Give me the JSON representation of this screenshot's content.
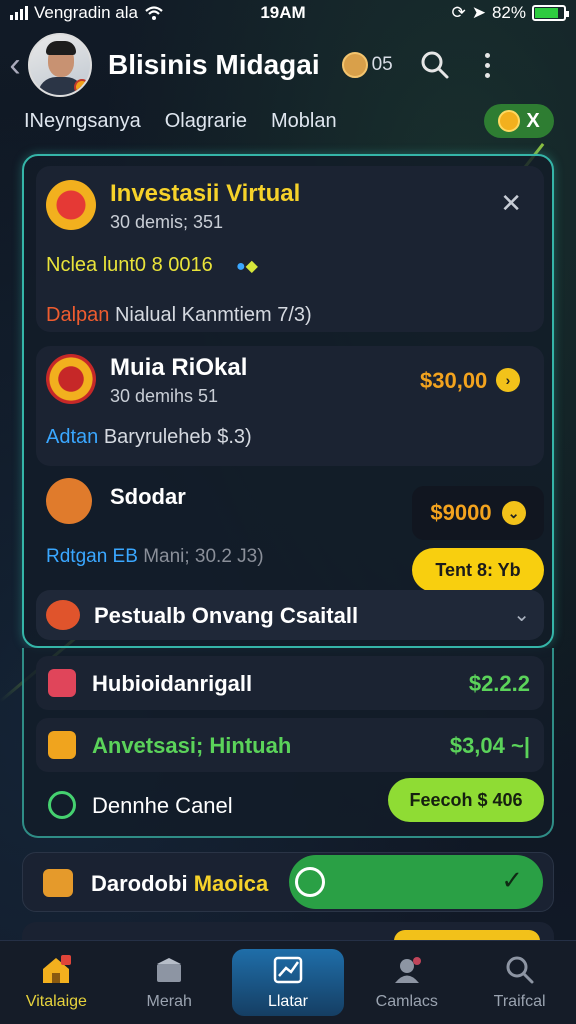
{
  "status_bar": {
    "carrier": "Vengradin ala",
    "time": "19AM",
    "battery": "82%",
    "battery_level": 0.82
  },
  "header": {
    "title": "Blisinis Midagai",
    "count": "05"
  },
  "tabs": {
    "items": [
      "INeyngsanya",
      "Olagrarie",
      "Moblan"
    ],
    "pill_label": "X"
  },
  "invest_card": {
    "title": "Investasii Virtual",
    "subtitle": "30 demis; 351",
    "line1": "Nclea lunt0 8 0016",
    "line2_label": "Dalpan",
    "line2_text": "Nialual Kanmtiem 7/3)"
  },
  "mua_card": {
    "title": "Muia RiOkal",
    "subtitle": "30 demihs 51",
    "price": "$30,00",
    "line_label": "Adtan",
    "line_text": "Baryruleheb $.3)"
  },
  "sodar_card": {
    "title": "Sdodar",
    "price": "$9000",
    "line_label": "Rdtgan EB",
    "line_text": "Mani; 30.2 J3)",
    "button": "Tent 8: Yb"
  },
  "footer_row": {
    "title": "Pestualb Onvang Csaitall"
  },
  "rows": [
    {
      "title": "Hubioidanrigall",
      "value": "$2.2.2"
    },
    {
      "title": "Anvetsasi; Hintuah",
      "value": "$3,04 ~|"
    },
    {
      "title": "Dennhe Canel",
      "button": "Feecoh $ 406"
    }
  ],
  "toggle_card": {
    "title_white": "Darodobi",
    "title_yellow": "Maoica"
  },
  "bottom_nav": {
    "items": [
      "Vitalaige",
      "Merah",
      "Llatar",
      "Camlacs",
      "Traifcal"
    ]
  },
  "colors": {
    "accent_teal": "#35b5a8",
    "accent_yellow": "#f6d22a",
    "accent_green": "#8fdc34",
    "price_orange": "#f3a31e"
  }
}
